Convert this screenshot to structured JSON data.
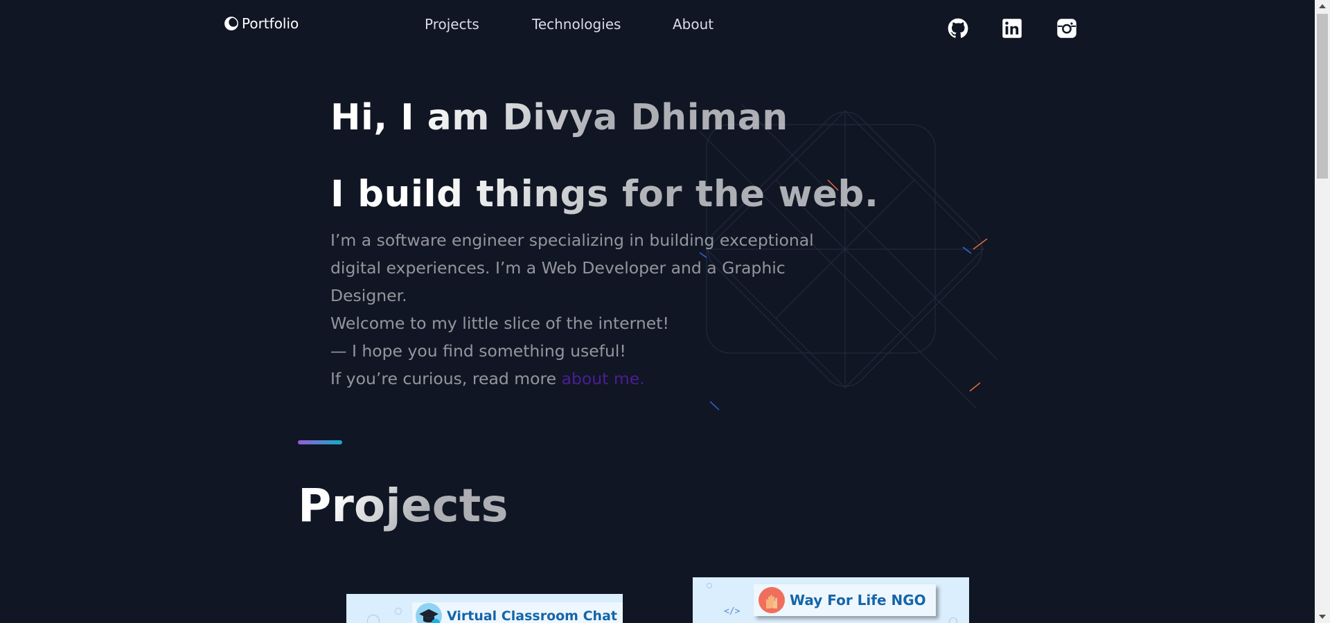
{
  "header": {
    "logo_text": "Portfolio",
    "logo_icon": "crescent-circle-icon",
    "nav": [
      {
        "label": "Projects"
      },
      {
        "label": "Technologies"
      },
      {
        "label": "About"
      }
    ],
    "social": [
      {
        "icon": "github-icon"
      },
      {
        "icon": "linkedin-icon"
      },
      {
        "icon": "instagram-icon"
      }
    ]
  },
  "hero": {
    "title": "Hi, I am Divya Dhiman",
    "subtitle": "I build things for the web.",
    "desc_line1": "I’m a software engineer specializing in building exceptional digital experiences. I’m a Web Developer and a Graphic Designer.",
    "desc_line2": "Welcome to my little slice of the internet!",
    "desc_line3": "— I hope you find something useful!",
    "desc_line4_prefix": "If you’re curious, read more ",
    "about_link": "about me."
  },
  "projects": {
    "title": "Projects",
    "cards": [
      {
        "banner": "Virtual Classroom Chat",
        "icon": "graduation-cap-icon"
      },
      {
        "banner": "Way For Life NGO",
        "icon": "hands-icon",
        "code_glyph": "</>"
      }
    ]
  },
  "colors": {
    "background": "#101624",
    "accent_link": "#4c1d95",
    "divider_start": "#945DD6",
    "divider_end": "#13ADC7"
  }
}
